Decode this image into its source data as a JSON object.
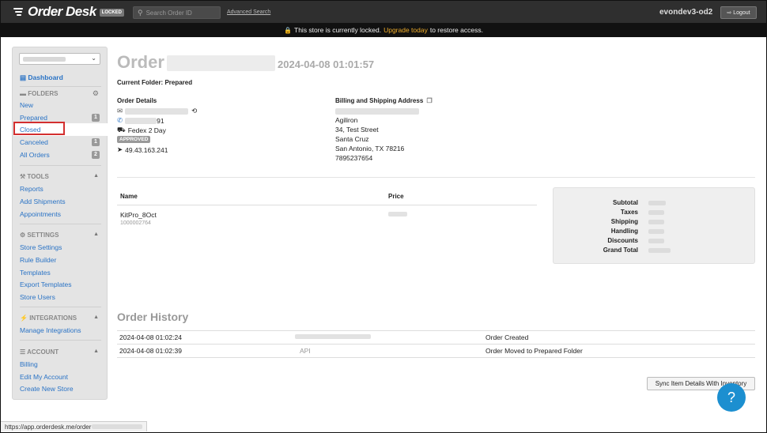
{
  "nav": {
    "brand": "Order Desk",
    "locked_badge": "LOCKED",
    "search_placeholder": "Search Order ID",
    "advanced_search": "Advanced Search",
    "store_name": "evondev3-od2",
    "logout": "Logout"
  },
  "banner": {
    "text_before": "This store is currently locked.",
    "upgrade_link": "Upgrade today",
    "text_after": "to restore access."
  },
  "sidebar": {
    "dashboard": "Dashboard",
    "folders_head": "FOLDERS",
    "folders": [
      {
        "label": "New",
        "count": ""
      },
      {
        "label": "Prepared",
        "count": "1"
      },
      {
        "label": "Closed",
        "count": ""
      },
      {
        "label": "Canceled",
        "count": "1"
      },
      {
        "label": "All Orders",
        "count": "2"
      }
    ],
    "tools_head": "TOOLS",
    "tools": [
      "Reports",
      "Add Shipments",
      "Appointments"
    ],
    "settings_head": "SETTINGS",
    "settings": [
      "Store Settings",
      "Rule Builder",
      "Templates",
      "Export Templates",
      "Store Users"
    ],
    "integrations_head": "INTEGRATIONS",
    "integrations": [
      "Manage Integrations"
    ],
    "account_head": "ACCOUNT",
    "account": [
      "Billing",
      "Edit My Account",
      "Create New Store"
    ]
  },
  "order": {
    "title": "Order",
    "date": "2024-04-08 01:01:57",
    "current_folder": "Current Folder: Prepared",
    "details_head": "Order Details",
    "phone_suffix": "91",
    "shipping_method": "Fedex 2 Day",
    "status_badge": "APPROVED",
    "ip": "49.43.163.241",
    "address_head": "Billing and Shipping Address",
    "address": [
      "Agiliron",
      "34, Test Street",
      "Santa Cruz",
      "San Antonio, TX 78216",
      "7895237654"
    ]
  },
  "items": {
    "col_name": "Name",
    "col_price": "Price",
    "rows": [
      {
        "name": "KitPro_8Oct",
        "sku": "1000002764"
      }
    ]
  },
  "totals": {
    "labels": [
      "Subtotal",
      "Taxes",
      "Shipping",
      "Handling",
      "Discounts",
      "Grand Total"
    ]
  },
  "history": {
    "title": "Order History",
    "rows": [
      {
        "time": "2024-04-08 01:02:24",
        "source": "",
        "event": "Order Created"
      },
      {
        "time": "2024-04-08 01:02:39",
        "source": "API",
        "event": "Order Moved to Prepared Folder"
      }
    ]
  },
  "actions": {
    "sync": "Sync Item Details With Inventory",
    "help": "?"
  },
  "status_bar": {
    "url": "https://app.orderdesk.me/order"
  }
}
